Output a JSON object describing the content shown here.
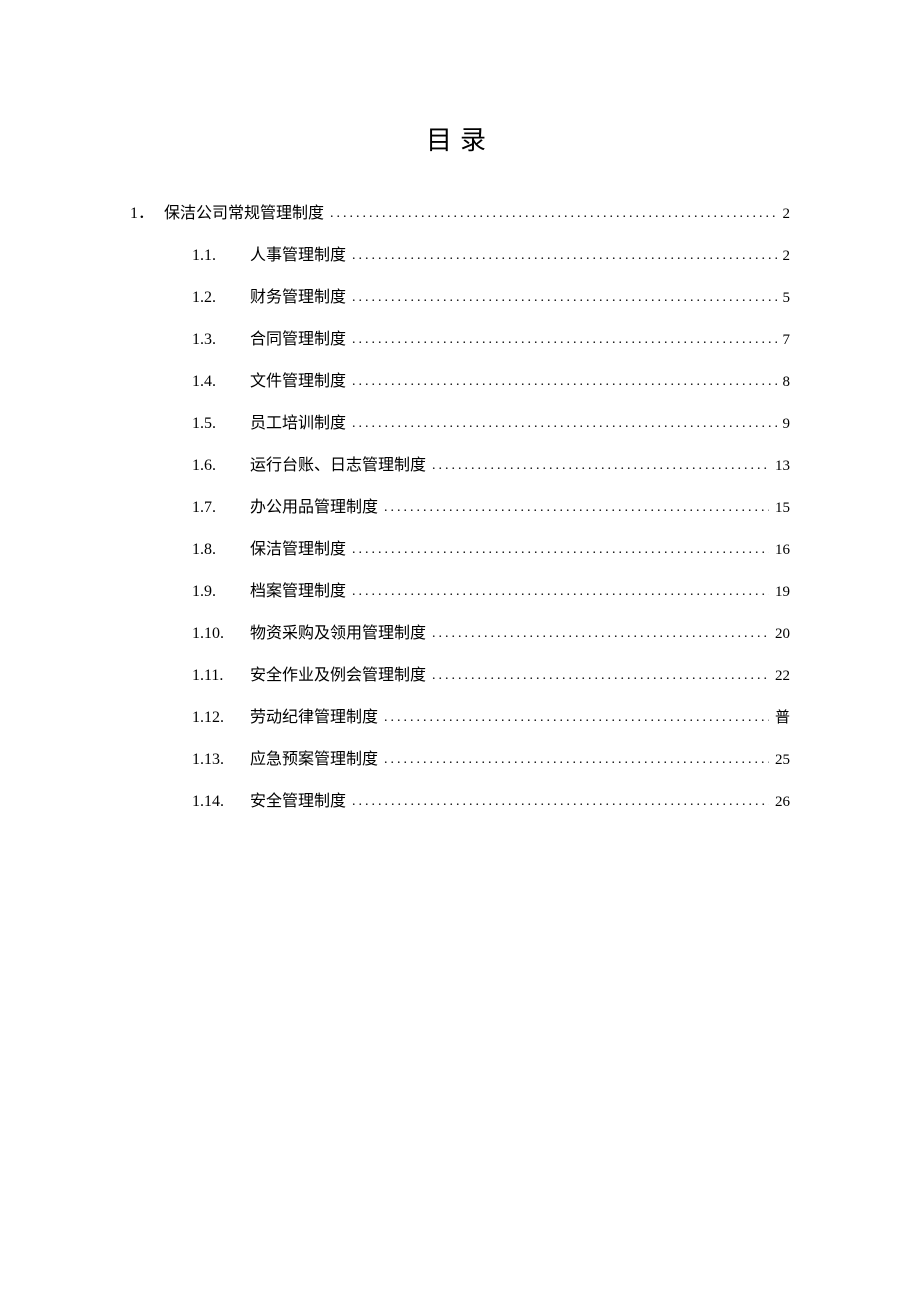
{
  "title": "目录",
  "dots": "..........................................................................................................",
  "l1": {
    "num": "1",
    "dot": "．",
    "label": "保洁公司常规管理制度",
    "page": "2"
  },
  "items": [
    {
      "num": "1.1.",
      "label": "人事管理制度",
      "page": "2"
    },
    {
      "num": "1.2.",
      "label": "财务管理制度",
      "page": "5"
    },
    {
      "num": "1.3.",
      "label": "合同管理制度",
      "page": "7"
    },
    {
      "num": "1.4.",
      "label": "文件管理制度",
      "page": "8"
    },
    {
      "num": "1.5.",
      "label": "员工培训制度",
      "page": "9"
    },
    {
      "num": "1.6.",
      "label": "运行台账、日志管理制度",
      "page": "13"
    },
    {
      "num": "1.7.",
      "label": "办公用品管理制度",
      "page": "15"
    },
    {
      "num": "1.8.",
      "label": "保洁管理制度",
      "page": "16"
    },
    {
      "num": "1.9.",
      "label": "档案管理制度",
      "page": "19"
    },
    {
      "num": "1.10.",
      "label": "物资采购及领用管理制度",
      "page": "20"
    },
    {
      "num": "1.11.",
      "label": "安全作业及例会管理制度",
      "page": "22"
    },
    {
      "num": "1.12.",
      "label": "劳动纪律管理制度",
      "page": "普"
    },
    {
      "num": "1.13.",
      "label": "应急预案管理制度",
      "page": "25"
    },
    {
      "num": "1.14.",
      "label": "安全管理制度",
      "page": "26"
    }
  ]
}
